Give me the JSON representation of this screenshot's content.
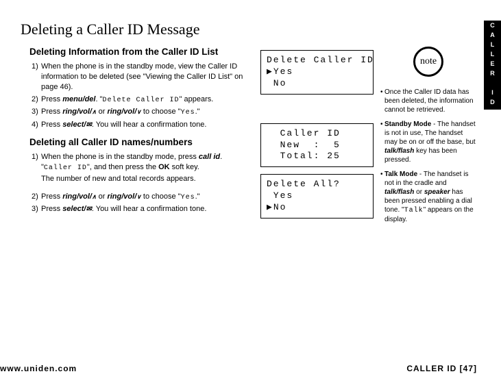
{
  "section_tab": "CALLER ID",
  "main_title": "Deleting a Caller ID Message",
  "sub1_heading": "Deleting Information from the Caller ID List",
  "sub1_step1_num": "1)",
  "sub1_step1_text": "When the phone is in the standby mode, view the Caller ID information to be deleted (see \"Viewing the Caller ID List\" on page 46).",
  "sub1_step2_num": "2)",
  "sub1_step2_pre": "Press ",
  "sub1_step2_key": "menu/del",
  "sub1_step2_mid": ". \"",
  "sub1_step2_mono": "Delete Caller ID",
  "sub1_step2_post": "\" appears.",
  "sub1_step3_num": "3)",
  "sub1_step3_pre": "Press ",
  "sub1_step3_key1": "ring/vol/",
  "sub1_step3_or": " or ",
  "sub1_step3_key2": "ring/vol/",
  "sub1_step3_mid": " to choose \"",
  "sub1_step3_mono": "Yes",
  "sub1_step3_post": ".\"",
  "sub1_step4_num": "4)",
  "sub1_step4_pre": "Press ",
  "sub1_step4_key": "select/",
  "sub1_step4_post": ". You will hear a confirmation tone.",
  "sub2_heading": "Deleting all Caller ID names/numbers",
  "sub2_step1_num": "1)",
  "sub2_step1_pre": "When the phone is in the standby mode, press ",
  "sub2_step1_key": "call id",
  "sub2_step1_mid": ". \"",
  "sub2_step1_mono": "Caller ID",
  "sub2_step1_mid2": "\", and then press the ",
  "sub2_step1_ok": "OK",
  "sub2_step1_post": " soft key.",
  "sub2_step1_cont": "The number of new and total records appears.",
  "sub2_step2_num": "2)",
  "sub2_step2_pre": "Press ",
  "sub2_step2_key1": "ring/vol/",
  "sub2_step2_or": " or ",
  "sub2_step2_key2": "ring/vol/",
  "sub2_step2_mid": " to choose \"",
  "sub2_step2_mono": "Yes",
  "sub2_step2_post": ".\"",
  "sub2_step3_num": "3)",
  "sub2_step3_pre": "Press ",
  "sub2_step3_key": "select/",
  "sub2_step3_post": ". You will hear a confirmation tone.",
  "lcd1_line1": "Delete Caller ID",
  "lcd1_line2": "▶Yes",
  "lcd1_line3": " No",
  "lcd2_line1": "  Caller ID",
  "lcd2_line2": "  New  :  5",
  "lcd2_line3": "  Total: 25",
  "lcd3_line1": "Delete All?",
  "lcd3_line2": " Yes",
  "lcd3_line3": "▶No",
  "note_label": "note",
  "note1": "Once the Caller ID data has been deleted, the information cannot be retrieved.",
  "note2_bold": "Standby Mode",
  "note2_text": " - The handset is not in use, The handset may be on or off the base, but ",
  "note2_key": "talk/flash",
  "note2_text2": " key has been pressed.",
  "note3_bold": "Talk Mode",
  "note3_text": " - The handset is not in the cradle and ",
  "note3_key1": "talk/flash",
  "note3_or": " or ",
  "note3_key2": "speaker",
  "note3_text2": " has been pressed enabling a dial tone. \"",
  "note3_mono": "Talk",
  "note3_text3": "\" appears on the display.",
  "footer_left": "www.uniden.com",
  "footer_right": "CALLER ID [47]"
}
